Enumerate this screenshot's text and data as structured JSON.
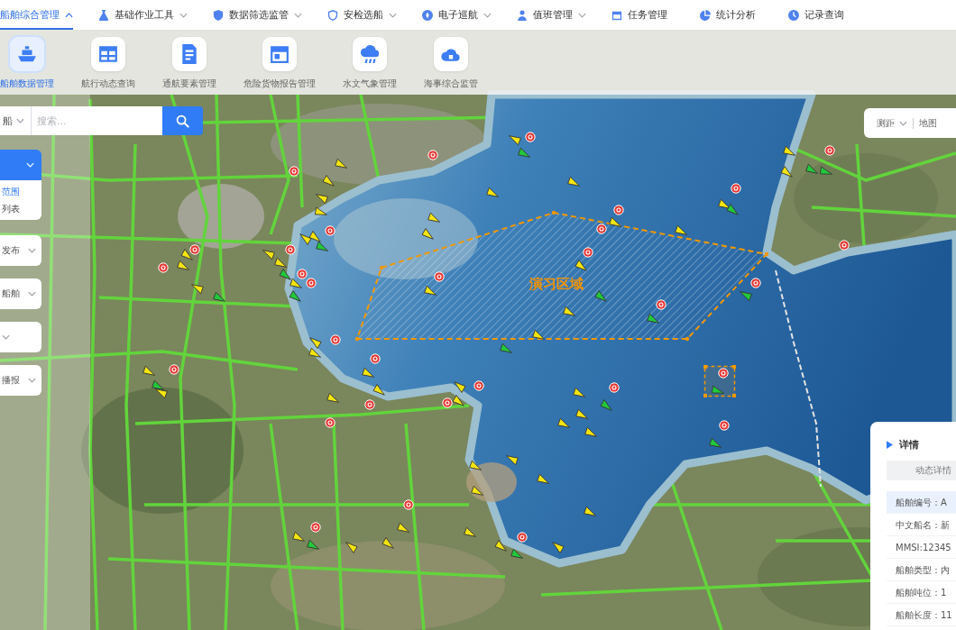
{
  "nav": [
    {
      "label": "船舶综合管理",
      "selected": true,
      "dropdown": true
    },
    {
      "label": "基础作业工具",
      "selected": false,
      "dropdown": true
    },
    {
      "label": "数据筛选监管",
      "selected": false,
      "dropdown": true
    },
    {
      "label": "安检选船",
      "selected": false,
      "dropdown": true
    },
    {
      "label": "电子巡航",
      "selected": false,
      "dropdown": true
    },
    {
      "label": "值班管理",
      "selected": false,
      "dropdown": true
    },
    {
      "label": "任务管理",
      "selected": false,
      "dropdown": false
    },
    {
      "label": "统计分析",
      "selected": false,
      "dropdown": false
    },
    {
      "label": "记录查询",
      "selected": false,
      "dropdown": false
    }
  ],
  "toolbar": [
    {
      "label": "船舶数据管理",
      "selected": true
    },
    {
      "label": "航行动态查询",
      "selected": false
    },
    {
      "label": "通航要素管理",
      "selected": false
    },
    {
      "label": "危险货物报告管理",
      "selected": false
    },
    {
      "label": "水文气象管理",
      "selected": false
    },
    {
      "label": "海事综合监管",
      "selected": false
    }
  ],
  "search": {
    "scope": "船",
    "placeholder": "搜索..."
  },
  "layer_menu": {
    "expanded": true,
    "items": [
      {
        "label": "范围",
        "selected": true
      },
      {
        "label": "列表",
        "selected": false
      }
    ]
  },
  "filters": [
    {
      "kind": "select",
      "value": "发布"
    },
    {
      "kind": "select",
      "value": "船舶"
    },
    {
      "kind": "select"
    },
    {
      "kind": "select",
      "value": "播报"
    }
  ],
  "map_controls": {
    "tool": "测距",
    "layer": "地图"
  },
  "map": {
    "exercise_zone": {
      "label": "演习区域"
    },
    "markers": [
      {
        "kind": "ship",
        "color": "#f4e410",
        "selected": false
      },
      {
        "kind": "ship",
        "color": "#f4e410",
        "selected": false
      },
      {
        "kind": "ship",
        "color": "#f4e410",
        "selected": false
      },
      {
        "kind": "ship",
        "color": "#f4e410",
        "selected": false
      },
      {
        "kind": "ship",
        "color": "#f4e410",
        "selected": false
      },
      {
        "kind": "ship",
        "color": "#22c83a",
        "selected": false
      },
      {
        "kind": "ship",
        "color": "#f4e410",
        "selected": false
      },
      {
        "kind": "ship",
        "color": "#f4e410",
        "selected": false
      },
      {
        "kind": "ship",
        "color": "#22c83a",
        "selected": false
      },
      {
        "kind": "ship",
        "color": "#f4e410",
        "selected": false
      },
      {
        "kind": "ship",
        "color": "#f4e410",
        "selected": false
      },
      {
        "kind": "ship",
        "color": "#22c83a",
        "selected": false
      },
      {
        "kind": "ship",
        "color": "#f4e410",
        "selected": false
      },
      {
        "kind": "ship",
        "color": "#f4e410",
        "selected": false
      },
      {
        "kind": "ship",
        "color": "#f4e410",
        "selected": false
      },
      {
        "kind": "ship",
        "color": "#22c83a",
        "selected": false
      },
      {
        "kind": "ship",
        "color": "#f4e410",
        "selected": false
      },
      {
        "kind": "ship",
        "color": "#22c83a",
        "selected": false
      },
      {
        "kind": "ship",
        "color": "#f4e410",
        "selected": false
      },
      {
        "kind": "ship",
        "color": "#f4e410",
        "selected": false
      },
      {
        "kind": "ship",
        "color": "#f4e410",
        "selected": false
      },
      {
        "kind": "ship",
        "color": "#f4e410",
        "selected": false
      },
      {
        "kind": "ship",
        "color": "#f4e410",
        "selected": false
      },
      {
        "kind": "ship",
        "color": "#f4e410",
        "selected": false
      },
      {
        "kind": "ship",
        "color": "#f4e410",
        "selected": false
      },
      {
        "kind": "ship",
        "color": "#f4e410",
        "selected": false
      },
      {
        "kind": "ship",
        "color": "#f4e410",
        "selected": false
      },
      {
        "kind": "ship",
        "color": "#f4e410",
        "selected": false
      },
      {
        "kind": "ship",
        "color": "#f4e410",
        "selected": false
      },
      {
        "kind": "ship",
        "color": "#f4e410",
        "selected": false
      },
      {
        "kind": "ship",
        "color": "#22c83a",
        "selected": false
      },
      {
        "kind": "ship",
        "color": "#f4e410",
        "selected": false
      },
      {
        "kind": "ship",
        "color": "#f4e410",
        "selected": false
      },
      {
        "kind": "ship",
        "color": "#22c83a",
        "selected": false
      },
      {
        "kind": "ship",
        "color": "#f4e410",
        "selected": false
      },
      {
        "kind": "ship",
        "color": "#f4e410",
        "selected": false
      },
      {
        "kind": "ship",
        "color": "#22c83a",
        "selected": false
      },
      {
        "kind": "ship",
        "color": "#22c83a",
        "selected": false
      },
      {
        "kind": "ship",
        "color": "#f4e410",
        "selected": false
      },
      {
        "kind": "ship",
        "color": "#f4e410",
        "selected": false
      },
      {
        "kind": "ship",
        "color": "#f4e410",
        "selected": false
      },
      {
        "kind": "ship",
        "color": "#22c83a",
        "selected": false
      },
      {
        "kind": "ship",
        "color": "#f4e410",
        "selected": false
      },
      {
        "kind": "ship",
        "color": "#f4e410",
        "selected": false
      },
      {
        "kind": "ship",
        "color": "#22c83a",
        "selected": false
      },
      {
        "kind": "ship",
        "color": "#22c83a",
        "selected": false
      },
      {
        "kind": "ship",
        "color": "#22c83a",
        "selected": false
      },
      {
        "kind": "ship",
        "color": "#f4e410",
        "selected": false
      },
      {
        "kind": "ship",
        "color": "#f4e410",
        "selected": false
      },
      {
        "kind": "ship",
        "color": "#22c83a",
        "selected": false
      },
      {
        "kind": "ship",
        "color": "#f4e410",
        "selected": false
      },
      {
        "kind": "ship",
        "color": "#f4e410",
        "selected": false
      },
      {
        "kind": "ship",
        "color": "#f4e410",
        "selected": false
      },
      {
        "kind": "ship",
        "color": "#22c83a",
        "selected": true
      },
      {
        "kind": "ship",
        "color": "#22c83a",
        "selected": false
      },
      {
        "kind": "ship",
        "color": "#f4e410",
        "selected": false
      },
      {
        "kind": "ship",
        "color": "#f4e410",
        "selected": false
      },
      {
        "kind": "ship",
        "color": "#f4e410",
        "selected": false
      },
      {
        "kind": "ship",
        "color": "#f4e410",
        "selected": false
      },
      {
        "kind": "ship",
        "color": "#f4e410",
        "selected": false
      },
      {
        "kind": "ship",
        "color": "#f4e410",
        "selected": false
      },
      {
        "kind": "ship",
        "color": "#f4e410",
        "selected": false
      },
      {
        "kind": "ship",
        "color": "#22c83a",
        "selected": false
      },
      {
        "kind": "ship",
        "color": "#f4e410",
        "selected": false
      },
      {
        "kind": "ship",
        "color": "#f4e410",
        "selected": false
      },
      {
        "kind": "ship",
        "color": "#22c83a",
        "selected": false
      },
      {
        "kind": "ship",
        "color": "#f4e410",
        "selected": false
      },
      {
        "kind": "ship",
        "color": "#f4e410",
        "selected": false
      },
      {
        "kind": "ship",
        "color": "#f4e410",
        "selected": false
      },
      {
        "kind": "alert",
        "selected": false
      },
      {
        "kind": "alert",
        "selected": false
      },
      {
        "kind": "alert",
        "selected": false
      },
      {
        "kind": "alert",
        "selected": false
      },
      {
        "kind": "alert",
        "selected": false
      },
      {
        "kind": "alert",
        "selected": false
      },
      {
        "kind": "alert",
        "selected": false
      },
      {
        "kind": "alert",
        "selected": false
      },
      {
        "kind": "alert",
        "selected": false
      },
      {
        "kind": "alert",
        "selected": false
      },
      {
        "kind": "alert",
        "selected": false
      },
      {
        "kind": "alert",
        "selected": false
      },
      {
        "kind": "alert",
        "selected": false
      },
      {
        "kind": "alert",
        "selected": false
      },
      {
        "kind": "alert",
        "selected": false
      },
      {
        "kind": "alert",
        "selected": false
      },
      {
        "kind": "alert",
        "selected": false
      },
      {
        "kind": "alert",
        "selected": false
      },
      {
        "kind": "alert",
        "selected": false
      },
      {
        "kind": "alert",
        "selected": false
      },
      {
        "kind": "alert",
        "selected": false
      },
      {
        "kind": "alert",
        "selected": false
      },
      {
        "kind": "alert",
        "selected": false
      },
      {
        "kind": "alert",
        "selected": false
      },
      {
        "kind": "alert",
        "selected": false
      },
      {
        "kind": "alert",
        "selected": false
      },
      {
        "kind": "alert",
        "selected": false
      },
      {
        "kind": "alert",
        "selected": false
      },
      {
        "kind": "alert",
        "selected": false
      },
      {
        "kind": "alert",
        "selected": false
      },
      {
        "kind": "alert",
        "selected": false
      }
    ]
  },
  "detail": {
    "title": "详情",
    "tab": "动态详情",
    "rows": [
      {
        "label": "船舶编号：",
        "value": "A",
        "selected": true
      },
      {
        "label": "中文船名：",
        "value": "新",
        "selected": false
      },
      {
        "label": "MMSI:",
        "value": "12345",
        "selected": false
      },
      {
        "label": "船舶类型：",
        "value": "内",
        "selected": false
      },
      {
        "label": "船舶吨位：",
        "value": "1",
        "selected": false
      },
      {
        "label": "船舶长度：",
        "value": "11",
        "selected": false
      }
    ]
  }
}
